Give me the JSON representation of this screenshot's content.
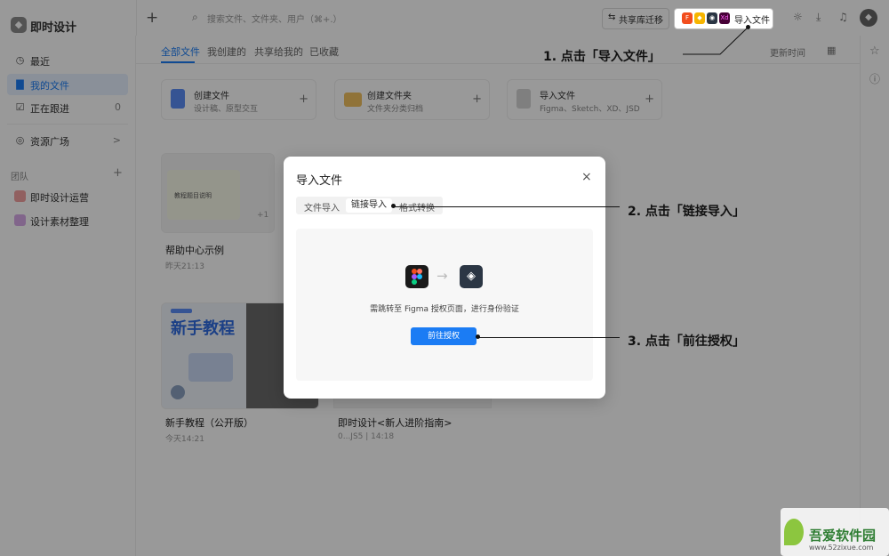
{
  "app": {
    "name": "即时设计",
    "logo_icon": "drop-logo-icon"
  },
  "sidebar": {
    "items": [
      {
        "label": "最近",
        "icon": "clock-icon"
      },
      {
        "label": "我的文件",
        "icon": "file-icon",
        "active": true
      },
      {
        "label": "正在跟进",
        "icon": "checkbox-icon",
        "count": "0"
      },
      {
        "label": "资源广场",
        "icon": "compass-icon",
        "chevron": ">"
      }
    ],
    "team_label": "团队",
    "team_add": "+",
    "teams": [
      {
        "label": "即时设计运营",
        "color": "#f2a0a0"
      },
      {
        "label": "设计素材整理",
        "color": "#d8a8e8"
      }
    ]
  },
  "topbar": {
    "plus": "+",
    "search_placeholder": "搜索文件、文件夹、用户（⌘+.）",
    "migrate_label": "共享库迁移",
    "import_label": "导入文件"
  },
  "main": {
    "tabs": [
      "全部文件",
      "我创建的",
      "共享给我的",
      "已收藏"
    ],
    "sort_label": "更新时间",
    "quick_cards": [
      {
        "title": "创建文件",
        "sub": "设计稿、原型交互",
        "color": "#5b8cf5"
      },
      {
        "title": "创建文件夹",
        "sub": "文件夹分类归档",
        "color": "#f0c060"
      },
      {
        "title": "导入文件",
        "sub": "Figma、Sketch、XD、JSD",
        "color": "#888888"
      }
    ],
    "files": [
      {
        "name": "帮助中心示例",
        "time": "昨天21:13",
        "thumb_text": "教程题目说明",
        "badge": "+1"
      },
      {
        "name": "新手教程（公开版）",
        "time": "今天14:21",
        "thumb_text": "新手教程"
      },
      {
        "name": "即时设计<新人进阶指南>",
        "time": "0...JS5 | 14:18"
      }
    ]
  },
  "modal": {
    "title": "导入文件",
    "close": "×",
    "tabs": [
      "文件导入",
      "链接导入",
      "格式转换"
    ],
    "active_tab": 1,
    "arrow": "→",
    "description": "需跳转至 Figma 授权页面，进行身份验证",
    "auth_button": "前往授权"
  },
  "annotations": [
    "1. 点击「导入文件」",
    "2. 点击「链接导入」",
    "3. 点击「前往授权」"
  ],
  "watermark": {
    "title": "吾爱软件园",
    "url": "www.52zixue.com"
  }
}
